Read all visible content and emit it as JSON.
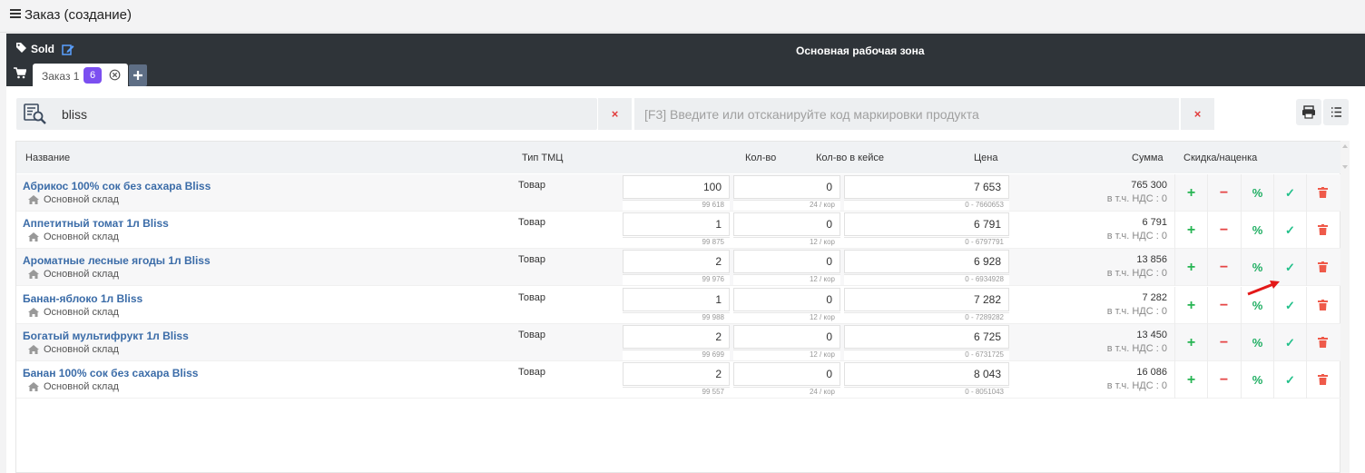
{
  "page": {
    "title": "Заказ (создание)"
  },
  "topbar": {
    "sold_label": "Sold",
    "workzone_title": "Основная рабочая зона"
  },
  "tab": {
    "label": "Заказ 1",
    "badge": "6"
  },
  "search": {
    "value": "bliss",
    "clear": "×"
  },
  "scan": {
    "placeholder": "[F3] Введите или отсканируйте код маркировки продукта",
    "clear": "×"
  },
  "table": {
    "headers": {
      "name": "Название",
      "type": "Тип ТМЦ",
      "qty": "Кол-во",
      "qty_case": "Кол-во в кейсе",
      "price": "Цена",
      "sum": "Сумма",
      "discount": "Скидка/наценка"
    },
    "rows": [
      {
        "name": "Абрикос 100% сок без сахара Bliss",
        "warehouse": "Основной склад",
        "type": "Товар",
        "qty": "100",
        "stock": "99 618",
        "case_qty": "0",
        "case_info": "24 / кор",
        "price": "7 653",
        "price_range": "0 - 7660653",
        "sum": "765 300",
        "vat": "в т.ч. НДС : 0"
      },
      {
        "name": "Аппетитный томат 1л Bliss",
        "warehouse": "Основной склад",
        "type": "Товар",
        "qty": "1",
        "stock": "99 875",
        "case_qty": "0",
        "case_info": "12 / кор",
        "price": "6 791",
        "price_range": "0 - 6797791",
        "sum": "6 791",
        "vat": "в т.ч. НДС : 0"
      },
      {
        "name": "Ароматные лесные ягоды 1л Bliss",
        "warehouse": "Основной склад",
        "type": "Товар",
        "qty": "2",
        "stock": "99 976",
        "case_qty": "0",
        "case_info": "12 / кор",
        "price": "6 928",
        "price_range": "0 - 6934928",
        "sum": "13 856",
        "vat": "в т.ч. НДС : 0"
      },
      {
        "name": "Банан-яблоко 1л Bliss",
        "warehouse": "Основной склад",
        "type": "Товар",
        "qty": "1",
        "stock": "99 988",
        "case_qty": "0",
        "case_info": "12 / кор",
        "price": "7 282",
        "price_range": "0 - 7289282",
        "sum": "7 282",
        "vat": "в т.ч. НДС : 0"
      },
      {
        "name": "Богатый мультифрукт 1л Bliss",
        "warehouse": "Основной склад",
        "type": "Товар",
        "qty": "2",
        "stock": "99 699",
        "case_qty": "0",
        "case_info": "12 / кор",
        "price": "6 725",
        "price_range": "0 - 6731725",
        "sum": "13 450",
        "vat": "в т.ч. НДС : 0"
      },
      {
        "name": "Банан 100% сок без сахара Bliss",
        "warehouse": "Основной склад",
        "type": "Товар",
        "qty": "2",
        "stock": "99 557",
        "case_qty": "0",
        "case_info": "24 / кор",
        "price": "8 043",
        "price_range": "0 - 8051043",
        "sum": "16 086",
        "vat": "в т.ч. НДС : 0"
      }
    ]
  },
  "actions": {
    "plus": "+",
    "minus": "−",
    "percent": "%",
    "confirm": "✓",
    "delete": "trash"
  },
  "colors": {
    "topbar": "#2f3439",
    "accent": "#7b4ff0",
    "link": "#3b6ca8",
    "green": "#27b553",
    "red": "#e54444"
  }
}
